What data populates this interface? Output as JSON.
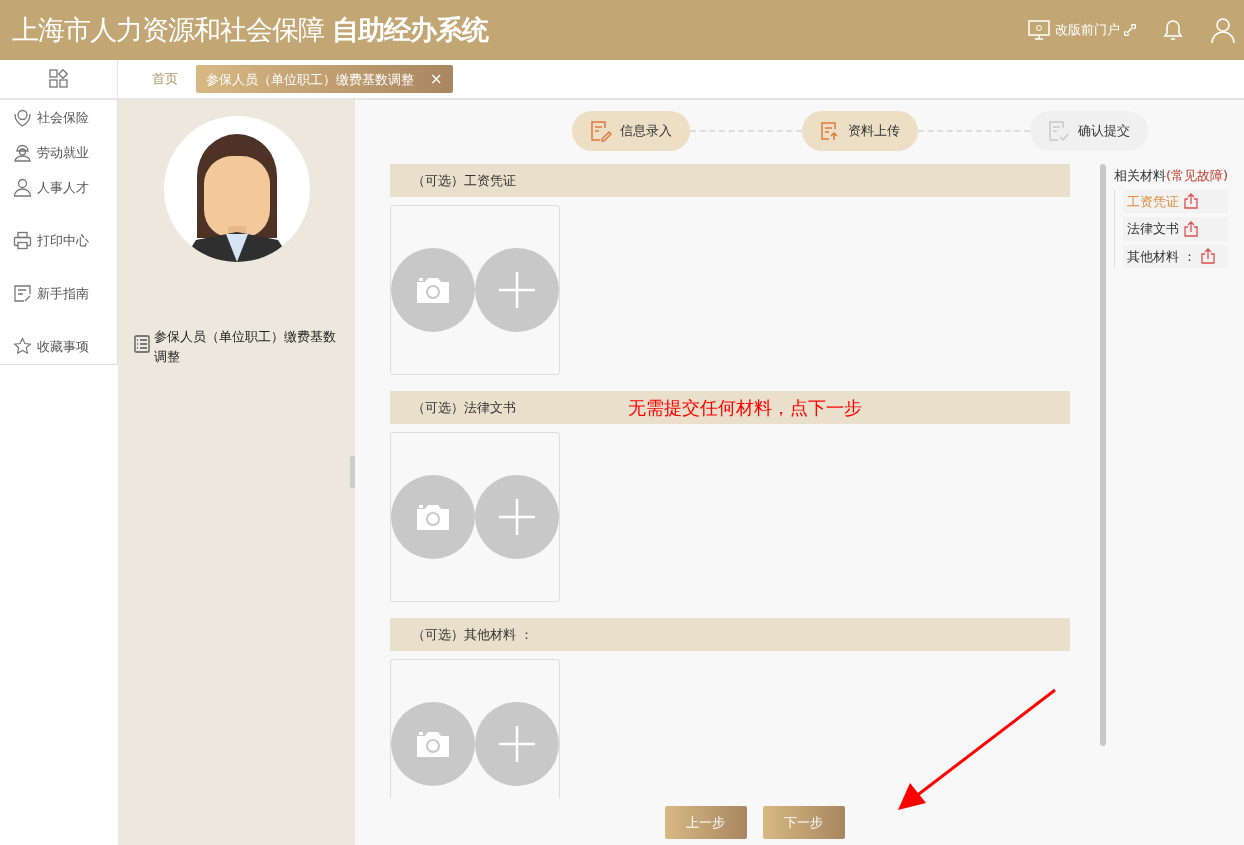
{
  "header": {
    "title": "上海市人力资源和社会保障",
    "title_bold": "自助经办系统",
    "portal_link": "改版前门户"
  },
  "tabs": [
    {
      "label": "首页",
      "selected": false
    },
    {
      "label": "参保人员（单位职工）缴费基数调整",
      "selected": true,
      "close": "×"
    }
  ],
  "sidebar": {
    "groups": [
      [
        {
          "label": "社会保险"
        },
        {
          "label": "劳动就业"
        },
        {
          "label": "人事人才"
        }
      ],
      [
        {
          "label": "打印中心"
        }
      ],
      [
        {
          "label": "新手指南"
        }
      ],
      [
        {
          "label": "收藏事项"
        }
      ]
    ]
  },
  "service": {
    "label": "参保人员（单位职工）缴费基数调整"
  },
  "steps": [
    {
      "label": "信息录入",
      "active": true
    },
    {
      "label": "资料上传",
      "active": true
    },
    {
      "label": "确认提交",
      "active": false
    }
  ],
  "sections": [
    {
      "title": "（可选）工资凭证"
    },
    {
      "title": "（可选）法律文书",
      "annotation": "无需提交任何材料，点下一步"
    },
    {
      "title": "（可选）其他材料 ："
    }
  ],
  "related": {
    "title": "相关材料",
    "link": "(常见故障)",
    "items": [
      {
        "label": "工资凭证",
        "selected": true
      },
      {
        "label": "法律文书",
        "selected": false
      },
      {
        "label": "其他材料 ：",
        "selected": false
      }
    ]
  },
  "buttons": [
    "上一步",
    "下一步"
  ]
}
